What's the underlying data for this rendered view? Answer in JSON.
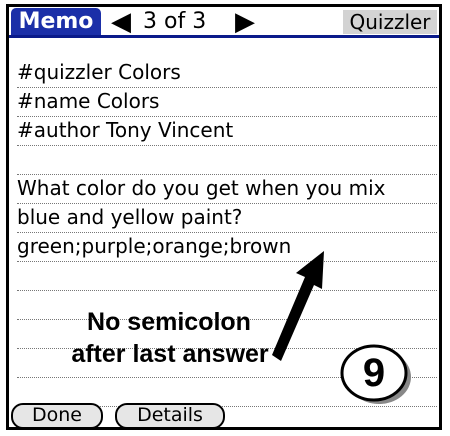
{
  "header": {
    "app_title": "Memo",
    "page_indicator": "3 of 3",
    "category": "Quizzler"
  },
  "memo": {
    "lines": [
      "#quizzler Colors",
      "#name Colors",
      "#author Tony Vincent",
      "",
      "What color do you get when you mix",
      "blue and yellow paint?",
      "green;purple;orange;brown",
      "",
      "",
      "",
      "",
      ""
    ]
  },
  "annotation": {
    "line1": "No semicolon",
    "line2": "after last answer",
    "badge_number": "9"
  },
  "buttons": {
    "done": "Done",
    "details": "Details"
  },
  "colors": {
    "title_bg": "#1b2fa8",
    "category_bg": "#d3d3d3"
  },
  "icons": {
    "prev": "triangle-left",
    "next": "triangle-right"
  }
}
